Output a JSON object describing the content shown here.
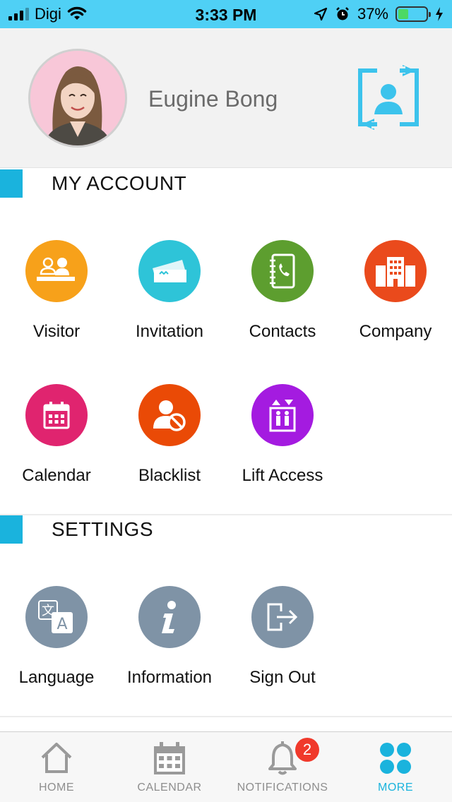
{
  "status_bar": {
    "carrier": "Digi",
    "time": "3:33 PM",
    "battery_percent": "37%",
    "battery_level": 0.37,
    "icons": [
      "signal-icon",
      "wifi-icon",
      "location-icon",
      "alarm-icon",
      "battery-icon",
      "charging-icon"
    ]
  },
  "profile": {
    "name": "Eugine Bong",
    "switch_icon": "switch-account-icon"
  },
  "sections": {
    "account": {
      "title": "MY ACCOUNT",
      "items": [
        {
          "label": "Visitor",
          "color": "#f7a11a",
          "icon": "visitor-icon"
        },
        {
          "label": "Invitation",
          "color": "#2ec4d8",
          "icon": "invitation-icon"
        },
        {
          "label": "Contacts",
          "color": "#5d9e2f",
          "icon": "contacts-icon"
        },
        {
          "label": "Company",
          "color": "#ea4a1c",
          "icon": "company-icon"
        },
        {
          "label": "Calendar",
          "color": "#e0246f",
          "icon": "calendar-icon"
        },
        {
          "label": "Blacklist",
          "color": "#ea4a06",
          "icon": "blacklist-icon"
        },
        {
          "label": "Lift Access",
          "color": "#a41be0",
          "icon": "lift-access-icon"
        }
      ]
    },
    "settings": {
      "title": "SETTINGS",
      "items": [
        {
          "label": "Language",
          "color": "#7f93a6",
          "icon": "language-icon"
        },
        {
          "label": "Information",
          "color": "#7f93a6",
          "icon": "information-icon"
        },
        {
          "label": "Sign Out",
          "color": "#7f93a6",
          "icon": "sign-out-icon"
        }
      ]
    }
  },
  "tabbar": {
    "home": "HOME",
    "calendar": "CALENDAR",
    "notifications": "NOTIFICATIONS",
    "notifications_badge": "2",
    "more": "MORE",
    "active": "more"
  },
  "colors": {
    "status_bar": "#4fd0f5",
    "accent": "#1ab3dd",
    "badge": "#f0392b"
  }
}
